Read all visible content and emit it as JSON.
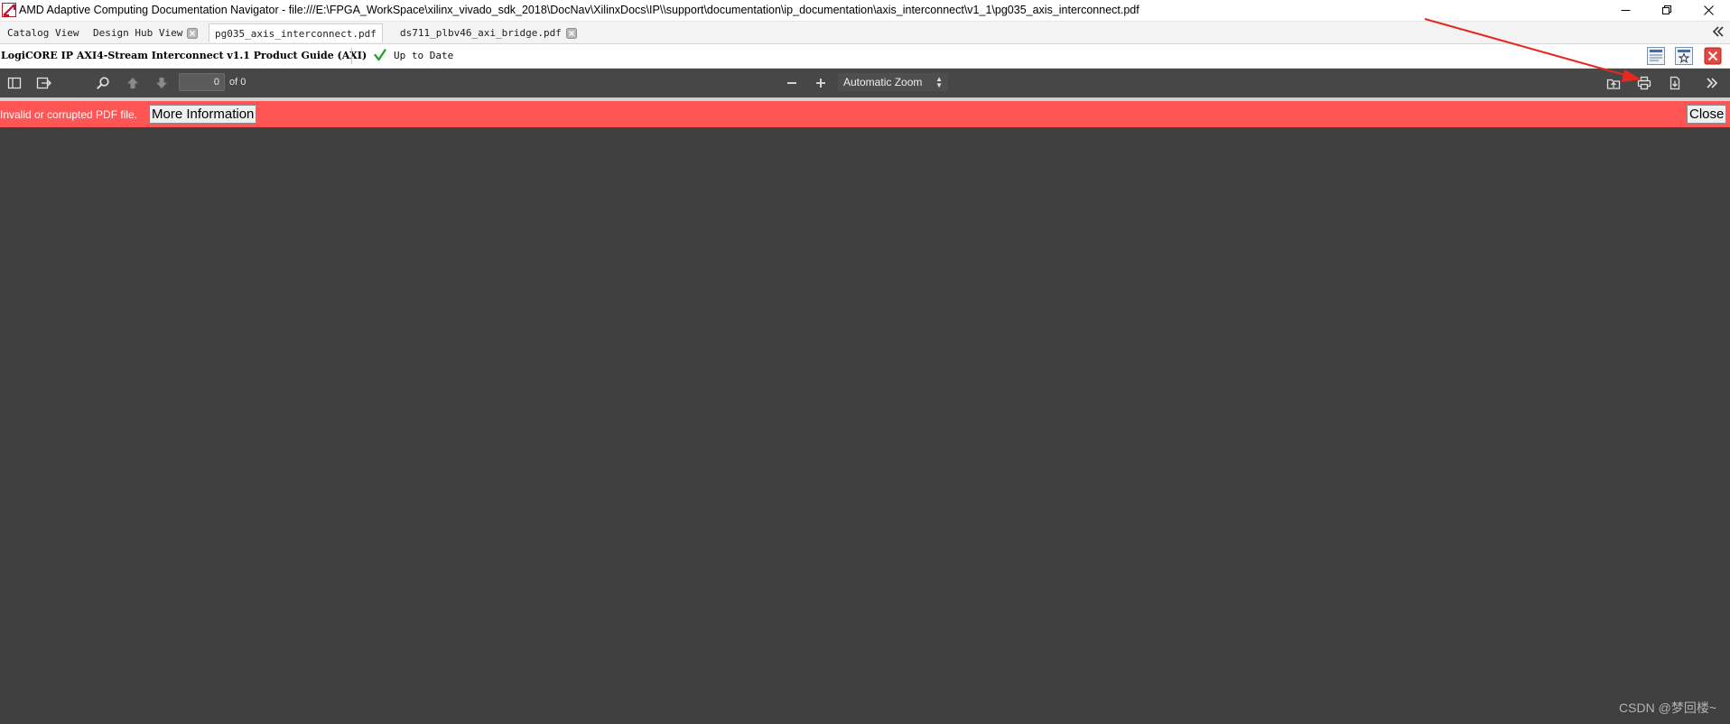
{
  "window": {
    "title": "AMD Adaptive Computing Documentation Navigator - file:///E:\\FPGA_WorkSpace\\xilinx_vivado_sdk_2018\\DocNav\\XilinxDocs\\IP\\\\support\\documentation\\ip_documentation\\axis_interconnect\\v1_1\\pg035_axis_interconnect.pdf"
  },
  "tabs": [
    {
      "label": "Catalog View",
      "closable": false,
      "active": false
    },
    {
      "label": "Design Hub View",
      "closable": true,
      "active": false
    },
    {
      "label": "pg035_axis_interconnect.pdf",
      "closable": true,
      "active": true
    },
    {
      "label": "ds711_plbv46_axi_bridge.pdf",
      "closable": true,
      "active": false
    }
  ],
  "document": {
    "title": "LogiCORE IP AXI4-Stream Interconnect v1.1 Product Guide (AXI)",
    "status": "Up to Date",
    "status_color": "#2aa52a"
  },
  "toolbar": {
    "page_number": "0",
    "page_count": "of 0",
    "zoom": "Automatic Zoom"
  },
  "error": {
    "message": "Invalid or corrupted PDF file.",
    "more_info_label": "More Information",
    "close_label": "Close",
    "bar_color": "#ff5555"
  },
  "watermark": "CSDN @梦回楼~",
  "annotation": {
    "arrow_color": "#e8271e"
  }
}
